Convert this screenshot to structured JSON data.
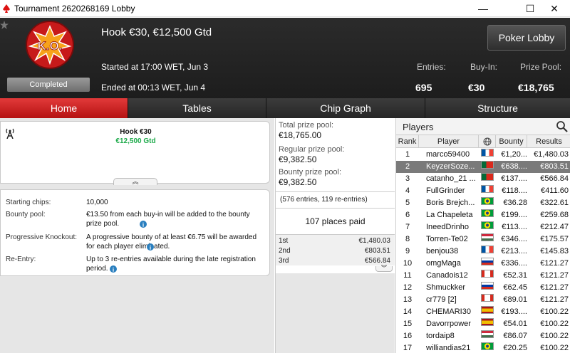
{
  "window": {
    "title": "Tournament 2620268169 Lobby",
    "minimize": "—",
    "maximize": "☐",
    "close": "✕"
  },
  "header": {
    "logo_text": "K.O.",
    "status": "Completed",
    "name": "Hook €30, €12,500 Gtd",
    "started": "Started at 17:00 WET, Jun 3",
    "ended": "Ended at 00:13 WET, Jun 4",
    "entries_label": "Entries:",
    "entries_value": "695",
    "buyin_label": "Buy-In:",
    "buyin_value": "€30",
    "prizepool_label": "Prize Pool:",
    "prizepool_value": "€18,765",
    "lobby_button": "Poker Lobby"
  },
  "tabs": [
    "Home",
    "Tables",
    "Chip Graph",
    "Structure"
  ],
  "home": {
    "card_title": "Hook €30",
    "card_guarantee": "€12,500 Gtd",
    "starting_chips_label": "Starting chips:",
    "starting_chips_value": "10,000",
    "bounty_pool_label": "Bounty pool:",
    "bounty_pool_value": "€13.50 from each buy-in will be added to the bounty prize pool.",
    "pko_label": "Progressive Knockout:",
    "pko_value": "A progressive bounty of at least €6.75 will be awarded for each player eliminated.",
    "reentry_label": "Re-Entry:",
    "reentry_value": "Up to 3 re-entries available during the late registration period."
  },
  "prizes": {
    "total_label": "Total prize pool:",
    "total_value": "€18,765.00",
    "regular_label": "Regular prize pool:",
    "regular_value": "€9,382.50",
    "bounty_label": "Bounty prize pool:",
    "bounty_value": "€9,382.50",
    "entries_note": "(576 entries, 119 re-entries)",
    "places_paid": "107 places paid",
    "payouts": [
      {
        "place": "1st",
        "amount": "€1,480.03"
      },
      {
        "place": "2nd",
        "amount": "€803.51"
      },
      {
        "place": "3rd",
        "amount": "€566.84"
      }
    ]
  },
  "players": {
    "title": "Players",
    "columns": [
      "Rank",
      "Player",
      "",
      "Bounty",
      "Results"
    ],
    "rows": [
      {
        "rank": "1",
        "name": "marco59400",
        "flag": "fr",
        "bounty": "€1,20...",
        "result": "€1,480.03"
      },
      {
        "rank": "2",
        "name": "KeyzerSoze...",
        "flag": "pt",
        "bounty": "€638....",
        "result": "€803.51"
      },
      {
        "rank": "3",
        "name": "catanho_21 ...",
        "flag": "pt",
        "bounty": "€137....",
        "result": "€566.84"
      },
      {
        "rank": "4",
        "name": "FullGrinder",
        "flag": "fr",
        "bounty": "€118....",
        "result": "€411.60"
      },
      {
        "rank": "5",
        "name": "Boris Brejch...",
        "flag": "br",
        "bounty": "€36.28",
        "result": "€322.61"
      },
      {
        "rank": "6",
        "name": "La Chapeleta",
        "flag": "br",
        "bounty": "€199....",
        "result": "€259.68"
      },
      {
        "rank": "7",
        "name": "IneedDrinho",
        "flag": "br",
        "bounty": "€113....",
        "result": "€212.47"
      },
      {
        "rank": "8",
        "name": "Torren-Te02",
        "flag": "hu",
        "bounty": "€346....",
        "result": "€175.57"
      },
      {
        "rank": "9",
        "name": "benjou38",
        "flag": "fr",
        "bounty": "€213....",
        "result": "€145.83"
      },
      {
        "rank": "10",
        "name": "omgMaga",
        "flag": "ru",
        "bounty": "€336....",
        "result": "€121.27"
      },
      {
        "rank": "11",
        "name": "Canadois12",
        "flag": "ca",
        "bounty": "€52.31",
        "result": "€121.27"
      },
      {
        "rank": "12",
        "name": "Shmuckker",
        "flag": "ru",
        "bounty": "€62.45",
        "result": "€121.27"
      },
      {
        "rank": "13",
        "name": "cr779 [2]",
        "flag": "ca",
        "bounty": "€89.01",
        "result": "€121.27"
      },
      {
        "rank": "14",
        "name": "CHEMARI30",
        "flag": "es",
        "bounty": "€193....",
        "result": "€100.22"
      },
      {
        "rank": "15",
        "name": "Davorrpower",
        "flag": "es",
        "bounty": "€54.01",
        "result": "€100.22"
      },
      {
        "rank": "16",
        "name": "tordaip8",
        "flag": "hu",
        "bounty": "€86.07",
        "result": "€100.22"
      },
      {
        "rank": "17",
        "name": "williandias21",
        "flag": "br",
        "bounty": "€20.25",
        "result": "€100.22"
      }
    ]
  }
}
